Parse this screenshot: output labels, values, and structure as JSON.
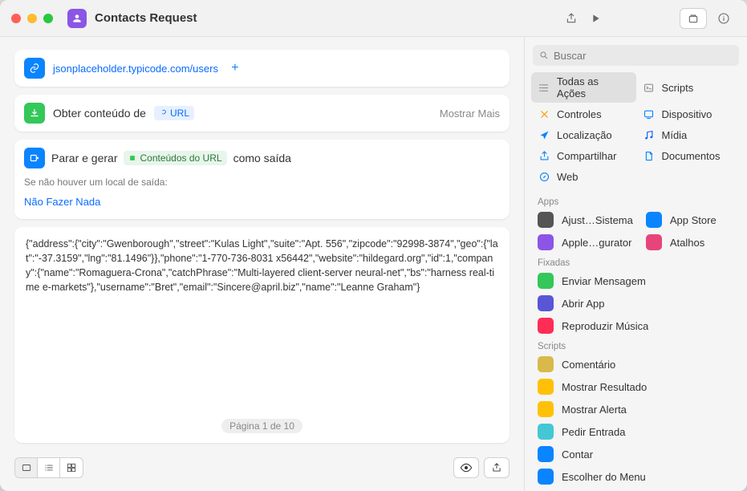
{
  "title": "Contacts Request",
  "url_action": {
    "url": "jsonplaceholder.typicode.com/users"
  },
  "get_action": {
    "title": "Obter conteúdo de",
    "token": "URL",
    "show_more": "Mostrar Mais"
  },
  "output_action": {
    "title": "Parar e gerar",
    "token": "Conteúdos do URL",
    "suffix": "como saída",
    "fallback_label": "Se não houver um local de saída:",
    "fallback_value": "Não Fazer Nada"
  },
  "output_text": "{\"address\":{\"city\":\"Gwenborough\",\"street\":\"Kulas Light\",\"suite\":\"Apt. 556\",\"zipcode\":\"92998-3874\",\"geo\":{\"lat\":\"-37.3159\",\"lng\":\"81.1496\"}},\"phone\":\"1-770-736-8031 x56442\",\"website\":\"hildegard.org\",\"id\":1,\"company\":{\"name\":\"Romaguera-Crona\",\"catchPhrase\":\"Multi-layered client-server neural-net\",\"bs\":\"harness real-time e-markets\"},\"username\":\"Bret\",\"email\":\"Sincere@april.biz\",\"name\":\"Leanne Graham\"}",
  "pager": "Página 1 de 10",
  "search_placeholder": "Buscar",
  "categories": [
    {
      "label": "Todas as Ações",
      "color": "#8e8e93",
      "icon": "list",
      "selected": true
    },
    {
      "label": "Scripts",
      "color": "#8e8e93",
      "icon": "terminal"
    },
    {
      "label": "Controles",
      "color": "#ff9500",
      "icon": "x"
    },
    {
      "label": "Dispositivo",
      "color": "#0a84ff",
      "icon": "device"
    },
    {
      "label": "Localização",
      "color": "#0a84ff",
      "icon": "location"
    },
    {
      "label": "Mídia",
      "color": "#0a5bff",
      "icon": "music"
    },
    {
      "label": "Compartilhar",
      "color": "#0a84ff",
      "icon": "share"
    },
    {
      "label": "Documentos",
      "color": "#0a84ff",
      "icon": "doc"
    },
    {
      "label": "Web",
      "color": "#0a84ff",
      "icon": "safari"
    }
  ],
  "apps_label": "Apps",
  "apps": [
    {
      "label": "Ajust…Sistema",
      "color": "#555"
    },
    {
      "label": "App Store",
      "color": "#0a84ff"
    },
    {
      "label": "Apple…gurator",
      "color": "#8b55e6"
    },
    {
      "label": "Atalhos",
      "color": "#e6457a"
    }
  ],
  "pinned_label": "Fixadas",
  "pinned": [
    {
      "label": "Enviar Mensagem",
      "color": "#34c759"
    },
    {
      "label": "Abrir App",
      "color": "#5856d6"
    },
    {
      "label": "Reproduzir Música",
      "color": "#ff2d55"
    }
  ],
  "scripts_label": "Scripts",
  "scripts": [
    {
      "label": "Comentário",
      "color": "#d9b94a"
    },
    {
      "label": "Mostrar Resultado",
      "color": "#ffc107"
    },
    {
      "label": "Mostrar Alerta",
      "color": "#ffc107"
    },
    {
      "label": "Pedir Entrada",
      "color": "#44c7d4"
    },
    {
      "label": "Contar",
      "color": "#0a84ff"
    },
    {
      "label": "Escolher do Menu",
      "color": "#0a84ff"
    }
  ]
}
